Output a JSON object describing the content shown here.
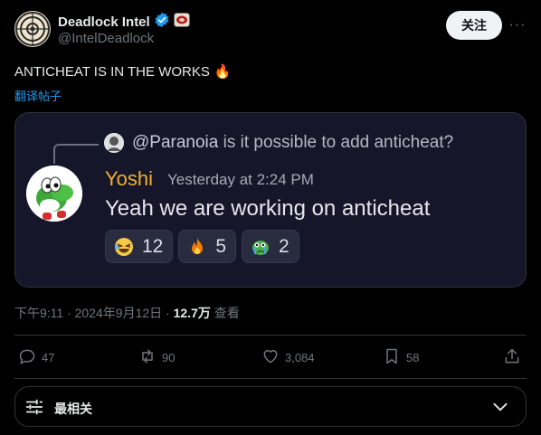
{
  "author": {
    "name": "Deadlock Intel",
    "handle": "@IntelDeadlock",
    "verified": true,
    "badge_color": "#1d9bf0"
  },
  "follow_label": "关注",
  "more_label": "···",
  "tweet": {
    "text": "ANTICHEAT IS IN THE WORKS",
    "emoji": "🔥",
    "translate_label": "翻译帖子"
  },
  "media": {
    "reply": {
      "mention": "@Paranoia",
      "text": " is it possible to add anticheat?"
    },
    "message": {
      "username": "Yoshi",
      "username_color": "#f0b232",
      "timestamp": "Yesterday at 2:24 PM",
      "body": "Yeah we are working on anticheat"
    },
    "reactions": [
      {
        "icon": "laughing-face-icon",
        "emoji": "🤣",
        "count": "12"
      },
      {
        "icon": "fire-icon",
        "emoji": "🔥",
        "count": "5"
      },
      {
        "icon": "crying-pepe-icon",
        "emoji": "🐸",
        "count": "2"
      }
    ]
  },
  "meta": {
    "time": "下午9:11 · 2024年9月12日 · ",
    "views": "12.7万",
    "views_label": " 查看"
  },
  "actions": {
    "replies": "47",
    "reposts": "90",
    "likes": "3,084",
    "bookmarks": "58"
  },
  "sort": {
    "label": "最相关"
  }
}
